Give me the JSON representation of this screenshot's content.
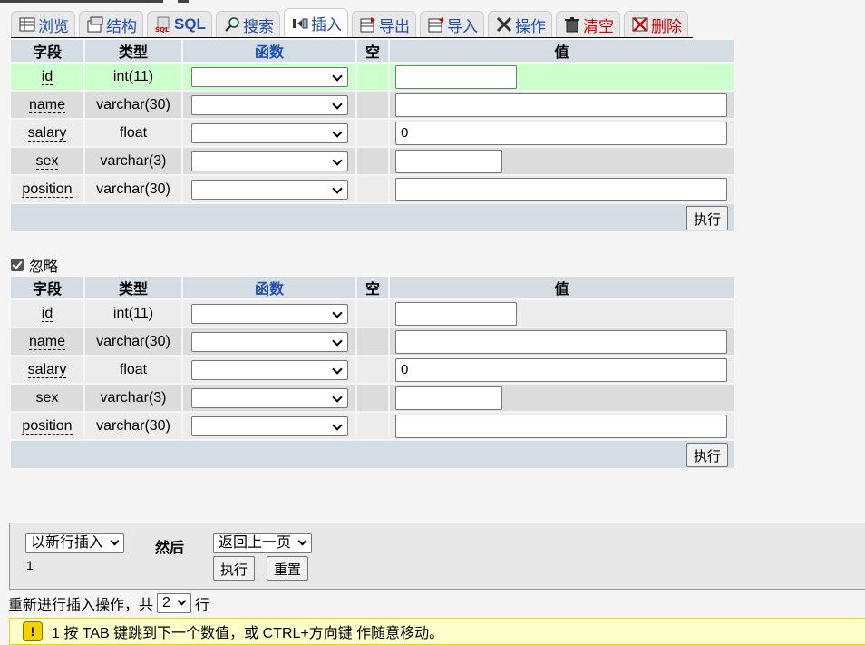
{
  "tabs": [
    {
      "label": "浏览",
      "icon": "browse-icon"
    },
    {
      "label": "结构",
      "icon": "structure-icon"
    },
    {
      "label": "SQL",
      "icon": "sql-icon"
    },
    {
      "label": "搜索",
      "icon": "search-icon"
    },
    {
      "label": "插入",
      "icon": "insert-icon",
      "active": true
    },
    {
      "label": "导出",
      "icon": "export-icon"
    },
    {
      "label": "导入",
      "icon": "import-icon"
    },
    {
      "label": "操作",
      "icon": "operations-icon"
    },
    {
      "label": "清空",
      "icon": "empty-icon"
    },
    {
      "label": "删除",
      "icon": "drop-icon"
    }
  ],
  "table_headers": {
    "field": "字段",
    "type": "类型",
    "function": "函数",
    "null": "空",
    "value": "值"
  },
  "form1": {
    "rows": [
      {
        "field": "id",
        "type": "int(11)",
        "value": ""
      },
      {
        "field": "name",
        "type": "varchar(30)",
        "value": ""
      },
      {
        "field": "salary",
        "type": "float",
        "value": "0"
      },
      {
        "field": "sex",
        "type": "varchar(3)",
        "value": ""
      },
      {
        "field": "position",
        "type": "varchar(30)",
        "value": ""
      }
    ],
    "go_label": "执行"
  },
  "ignore": {
    "label": "忽略",
    "checked": true
  },
  "form2": {
    "rows": [
      {
        "field": "id",
        "type": "int(11)",
        "value": ""
      },
      {
        "field": "name",
        "type": "varchar(30)",
        "value": ""
      },
      {
        "field": "salary",
        "type": "float",
        "value": "0"
      },
      {
        "field": "sex",
        "type": "varchar(3)",
        "value": ""
      },
      {
        "field": "position",
        "type": "varchar(30)",
        "value": ""
      }
    ],
    "go_label": "执行"
  },
  "bottom": {
    "insert_mode": "以新行插入",
    "then_label": "然后",
    "after_action": "返回上一页",
    "counter": "1",
    "go_label": "执行",
    "reset_label": "重置"
  },
  "repeat": {
    "prefix": "重新进行插入操作，共",
    "count": "2",
    "suffix": "行"
  },
  "notice": {
    "text": "1 按 TAB 键跳到下一个数值，或 CTRL+方向键 作随意移动。"
  },
  "colors": {
    "tab_link": "#1f4fb5",
    "tab_danger": "#d40000",
    "header_bg": "#d4dce4",
    "highlight_row": "#ccffcc"
  }
}
